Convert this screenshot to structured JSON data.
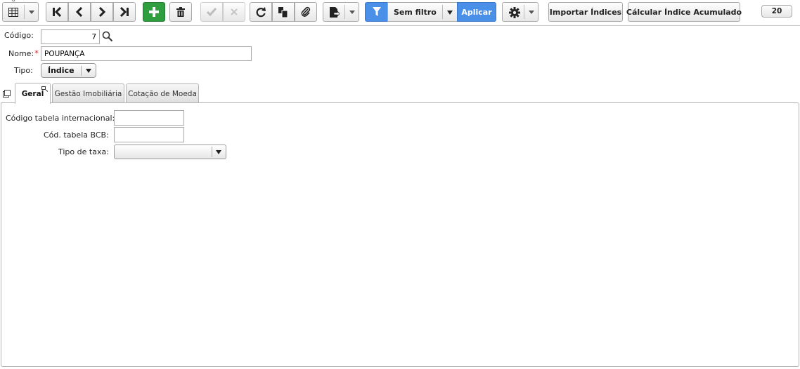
{
  "toolbar": {
    "tiny_badge": "•ó",
    "icons": {
      "grid": "grid-icon",
      "first": "first-record-icon",
      "prev": "previous-record-icon",
      "next": "next-record-icon",
      "last": "last-record-icon",
      "add": "add-icon",
      "delete": "trash-icon",
      "confirm": "check-icon",
      "cancel": "close-icon",
      "refresh": "refresh-icon",
      "copy": "copy-icon",
      "attach": "paperclip-icon",
      "export": "export-icon",
      "filter": "filter-icon",
      "settings": "gear-icon"
    },
    "filter_label": "Sem filtro",
    "apply_label": "Aplicar",
    "import_label": "Importar Índices",
    "calculate_label": "Cálcular Índice Acumulado",
    "page_size": "20",
    "colors": {
      "add_green": "#2e9e3f",
      "filter_blue": "#4a8fe8",
      "apply_blue": "#4a8fe8"
    }
  },
  "form": {
    "codigo_label": "Código:",
    "codigo_value": "7",
    "nome_label": "Nome:",
    "nome_required": "*",
    "nome_value": "POUPANÇA",
    "tipo_label": "Tipo:",
    "tipo_value": "Índice"
  },
  "tabs": [
    {
      "label": "Geral",
      "active": true
    },
    {
      "label": "Gestão Imobiliária",
      "active": false
    },
    {
      "label": "Cotação de Moeda",
      "active": false
    }
  ],
  "geral": {
    "codigo_internacional_label": "Código tabela internacional:",
    "codigo_internacional_value": "",
    "cod_bcb_label": "Cód. tabela BCB:",
    "cod_bcb_value": "",
    "tipo_taxa_label": "Tipo de taxa:",
    "tipo_taxa_value": ""
  }
}
